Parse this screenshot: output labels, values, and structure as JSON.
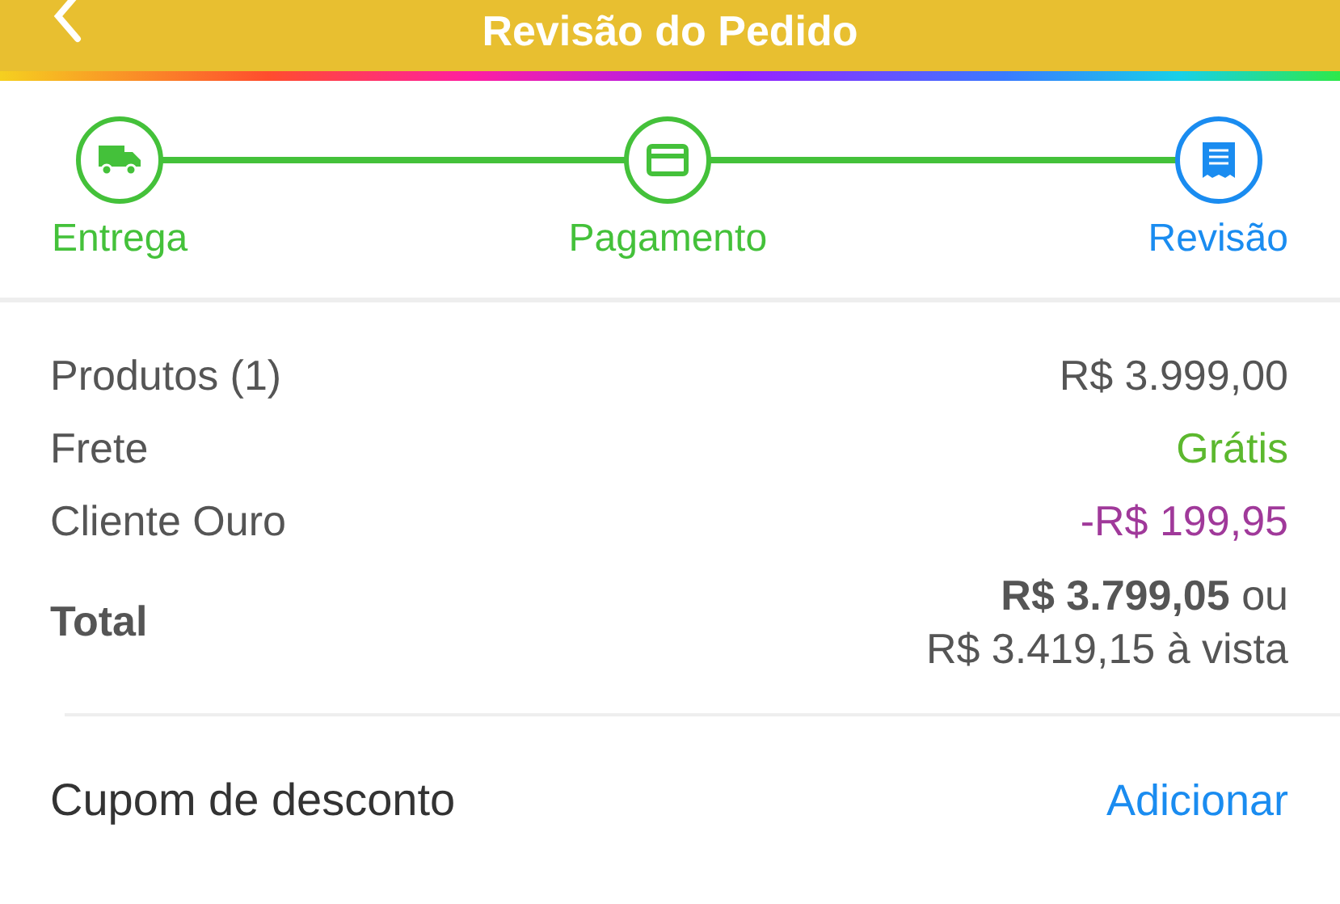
{
  "header": {
    "title": "Revisão do Pedido"
  },
  "steps": [
    {
      "label": "Entrega",
      "kind": "delivery",
      "selected": false
    },
    {
      "label": "Pagamento",
      "kind": "payment",
      "selected": false
    },
    {
      "label": "Revisão",
      "kind": "review",
      "selected": true
    }
  ],
  "summary": [
    {
      "label": "Produtos (1)",
      "value": "R$ 3.999,00",
      "kind": "plain"
    },
    {
      "label": "Frete",
      "value": "Grátis",
      "kind": "free"
    },
    {
      "label": "Cliente Ouro",
      "value": "-R$ 199,95",
      "kind": "discount"
    }
  ],
  "total": {
    "label": "Total",
    "lines": [
      "**R$ 3.799,05** ou",
      "R$ 3.419,15 à vista"
    ]
  },
  "coupon": {
    "label": "Cupom de desconto",
    "action": "Adicionar"
  }
}
